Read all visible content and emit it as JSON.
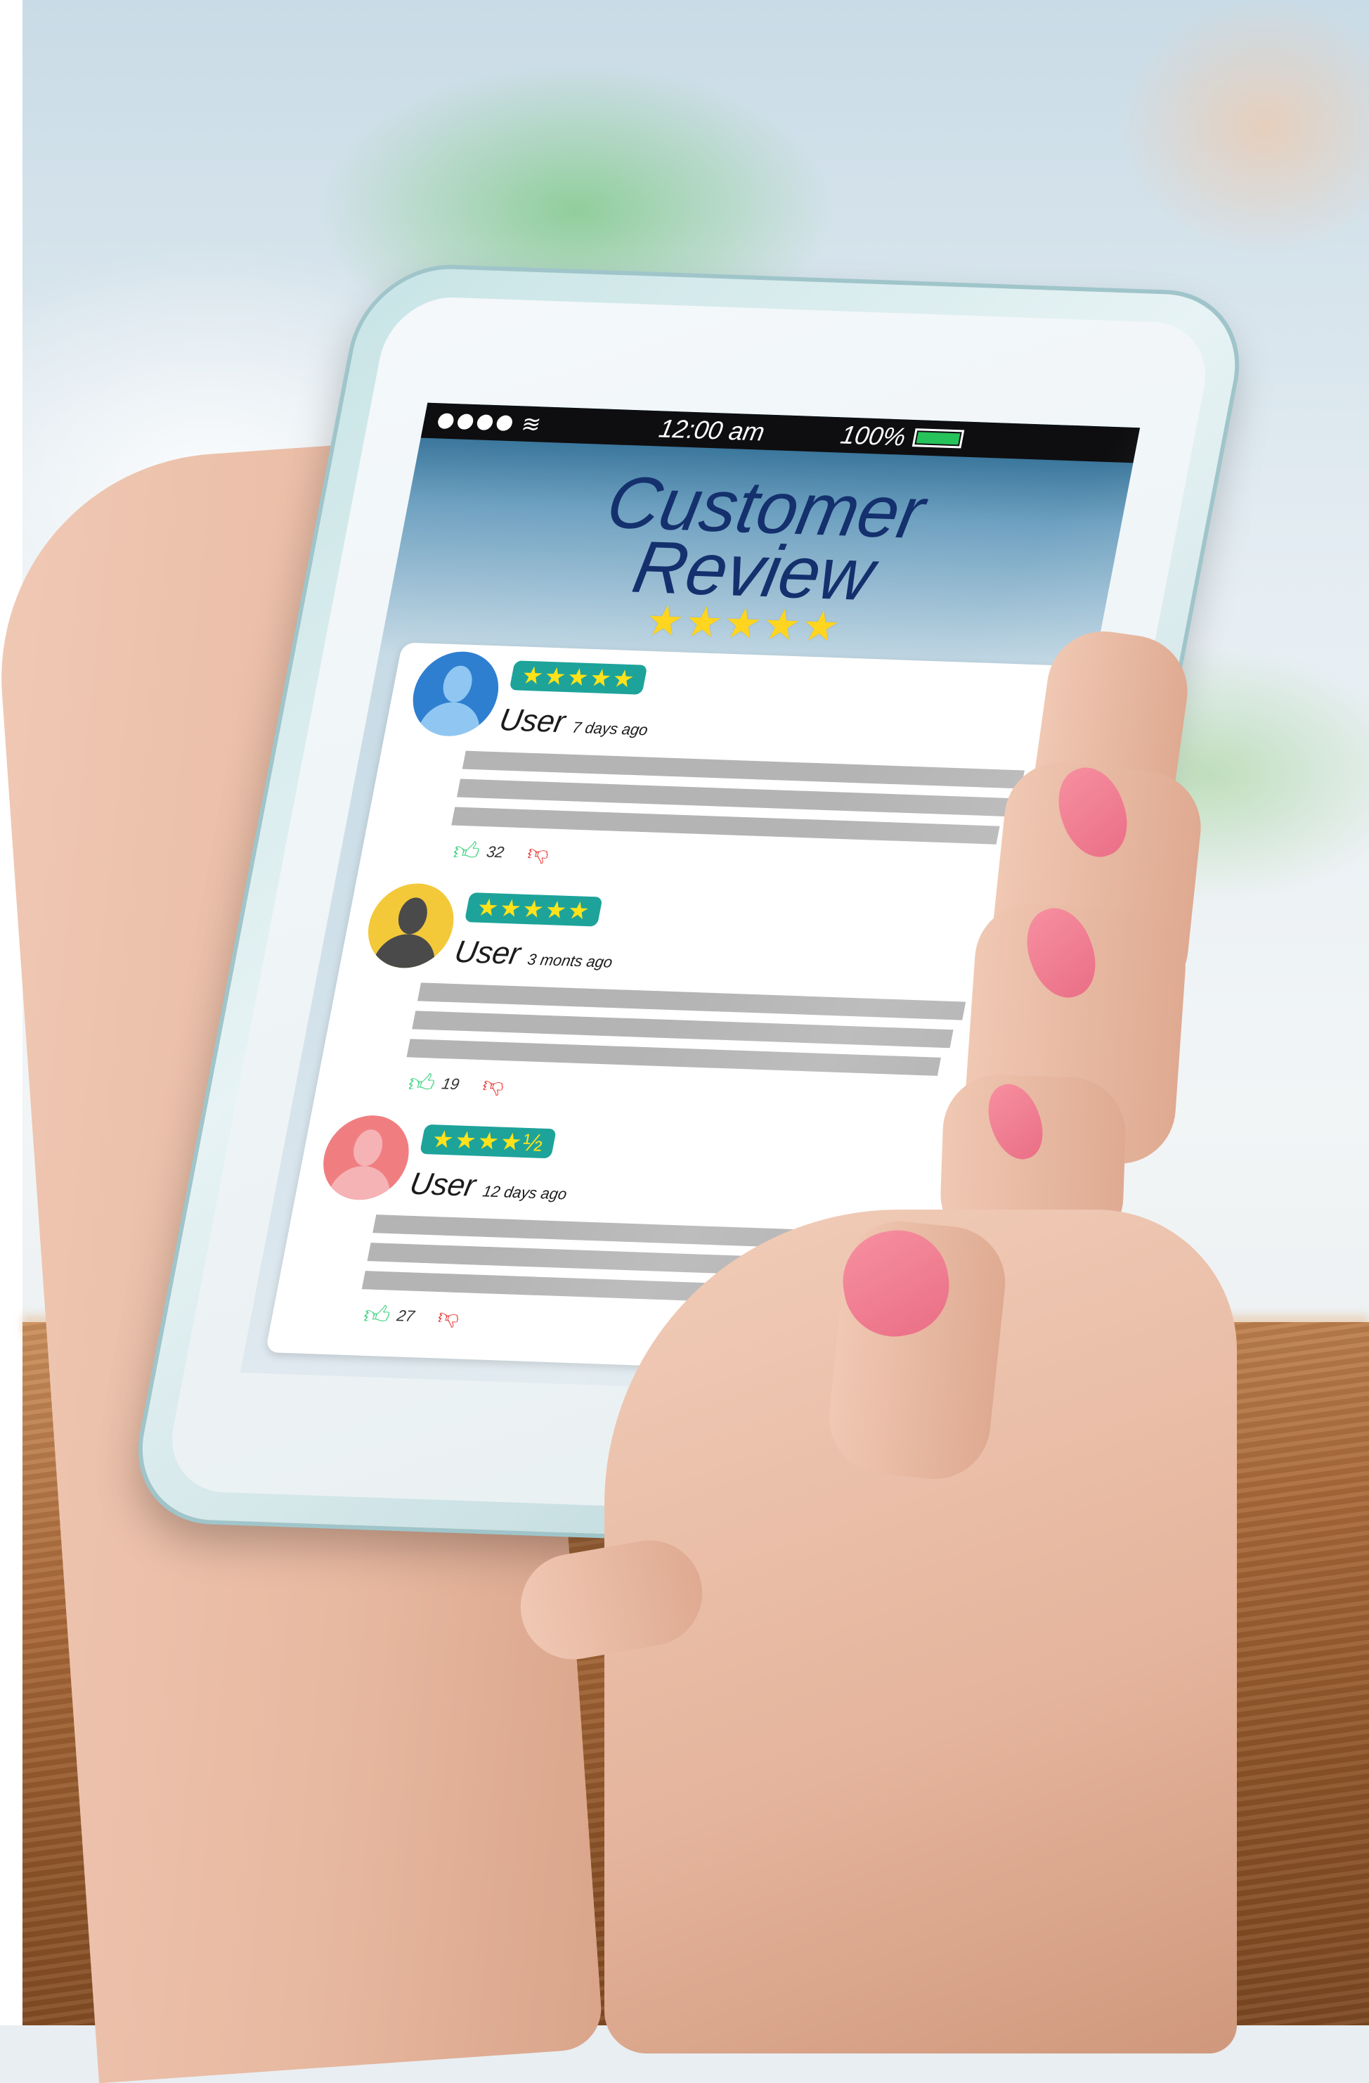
{
  "status_bar": {
    "time": "12:00 am",
    "battery": "100%",
    "battery_level": 1.0,
    "signal_icon": "signal-dots-icon",
    "wifi_icon": "wifi-icon"
  },
  "header": {
    "title_line1": "Customer",
    "title_line2": "Review",
    "stars": "★★★★★",
    "star_color": "#ffd51f",
    "title_color": "#14306d"
  },
  "reviews": [
    {
      "stars": "★★★★★",
      "rating": 5,
      "user": "User",
      "time": "7 days ago",
      "likes": "32",
      "avatar_color": "#2f7fd0",
      "avatar_figure_color": "#8fc7f2"
    },
    {
      "stars": "★★★★★",
      "rating": 5,
      "user": "User",
      "time": "3 monts ago",
      "likes": "19",
      "avatar_color": "#f3c93a",
      "avatar_figure_color": "#4a4a4a"
    },
    {
      "stars": "★★★★½",
      "rating": 4.5,
      "user": "User",
      "time": "12 days ago",
      "likes": "27",
      "avatar_color": "#f07e80",
      "avatar_figure_color": "#f5b3b5"
    }
  ],
  "colors": {
    "badge": "#1da39a",
    "like": "#4cd68a",
    "dislike": "#ee4040"
  }
}
